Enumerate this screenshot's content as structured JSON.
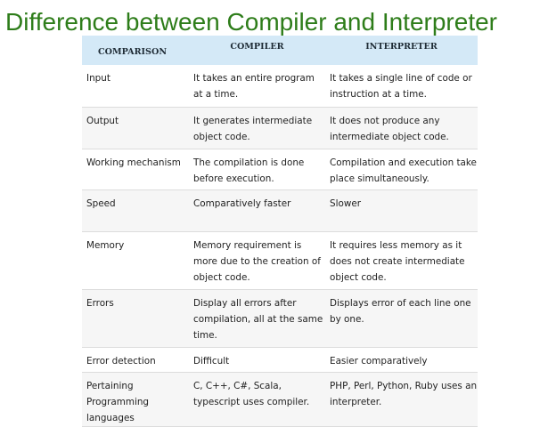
{
  "title": "Difference between Compiler and Interpreter",
  "table": {
    "headers": [
      "COMPARISON",
      "COMPILER",
      "INTERPRETER"
    ],
    "rows": [
      {
        "aspect": "Input",
        "compiler": "It takes an entire program at a time.",
        "interpreter": "It takes a single line of code or instruction at a time."
      },
      {
        "aspect": "Output",
        "compiler": "It generates intermediate object code.",
        "interpreter": "It does not produce any intermediate object code."
      },
      {
        "aspect": "Working mechanism",
        "compiler": "The compilation is done before execution.",
        "interpreter": "Compilation and execution take place simultaneously."
      },
      {
        "aspect": "Speed",
        "compiler": "Comparatively faster",
        "interpreter": "Slower"
      },
      {
        "aspect": "Memory",
        "compiler": "Memory requirement is more due to the creation of object code.",
        "interpreter": "It requires less memory as it does not create intermediate object code."
      },
      {
        "aspect": "Errors",
        "compiler": "Display all errors after compilation, all at the same time.",
        "interpreter": "Displays error of each line one by one."
      },
      {
        "aspect": "Error detection",
        "compiler": "Difficult",
        "interpreter": "Easier comparatively"
      },
      {
        "aspect": "Pertaining Programming languages",
        "compiler": "C, C++, C#, Scala, typescript uses compiler.",
        "interpreter": "PHP, Perl, Python, Ruby uses an interpreter."
      }
    ]
  }
}
